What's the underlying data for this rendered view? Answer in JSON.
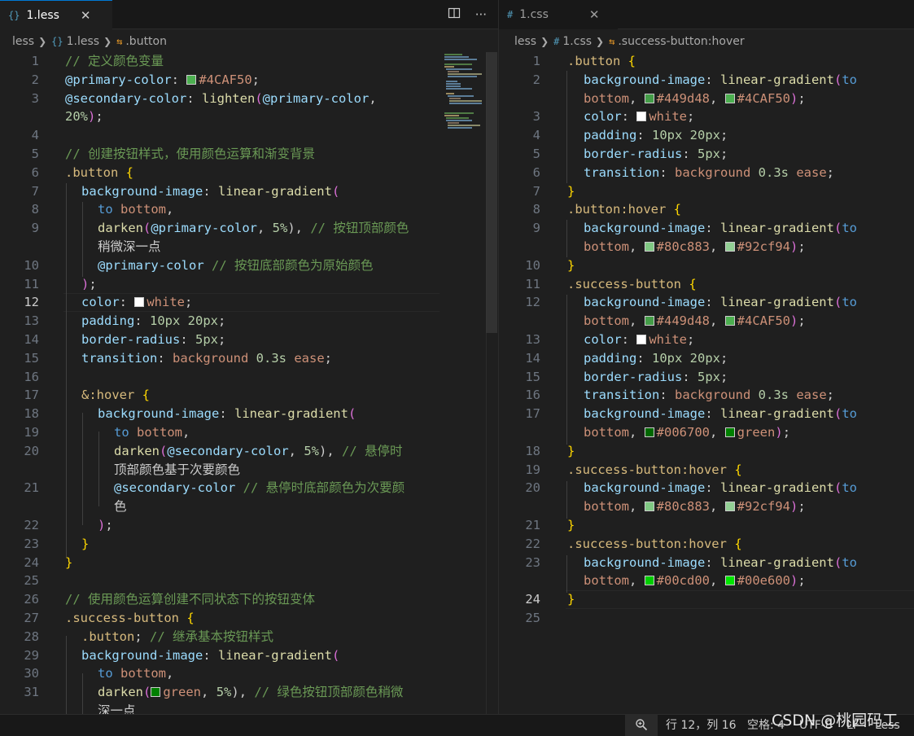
{
  "left_editor": {
    "tab": {
      "icon": "{}",
      "label": "1.less"
    },
    "breadcrumb": [
      "less",
      "1.less",
      ".button"
    ],
    "current_line": 12
  },
  "right_editor": {
    "tab": {
      "icon": "#",
      "label": "1.css"
    },
    "breadcrumb": [
      "less",
      "1.css",
      ".success-button:hover"
    ],
    "current_line": 24
  },
  "status": {
    "position": "行 12，列 16",
    "spaces": "空格: 4",
    "encoding": "UTF-8",
    "eol": "LF",
    "language": "Less"
  },
  "watermark": "CSDN @桃园码工",
  "colors": {
    "accent": "#0078d4",
    "swatch_449d48": "#449d48",
    "swatch_4CAF50": "#4CAF50",
    "swatch_white": "#ffffff",
    "swatch_80c883": "#80c883",
    "swatch_92cf94": "#92cf94",
    "swatch_006700": "#006700",
    "swatch_green": "#008000",
    "swatch_00cd00": "#00cd00",
    "swatch_00e600": "#00e600"
  },
  "icons": [
    "less-file-icon",
    "css-file-icon",
    "close-icon",
    "split-editor-icon",
    "more-actions-icon",
    "chevron-right-icon",
    "symbol-class-icon",
    "zoom-icon"
  ],
  "left_code": [
    {
      "n": "1",
      "t": "// 定义颜色变量"
    },
    {
      "n": "2",
      "t": "@primary-color: #4CAF50;"
    },
    {
      "n": "3",
      "t": "@secondary-color: lighten(@primary-color,"
    },
    {
      "n": "",
      "t": "20%);"
    },
    {
      "n": "4",
      "t": ""
    },
    {
      "n": "5",
      "t": "// 创建按钮样式，使用颜色运算和渐变背景"
    },
    {
      "n": "6",
      "t": ".button {"
    },
    {
      "n": "7",
      "t": "background-image: linear-gradient("
    },
    {
      "n": "8",
      "t": "to bottom,"
    },
    {
      "n": "9",
      "t": "darken(@primary-color, 5%), // 按钮顶部颜色"
    },
    {
      "n": "",
      "t": "稍微深一点"
    },
    {
      "n": "10",
      "t": "@primary-color // 按钮底部颜色为原始颜色"
    },
    {
      "n": "11",
      "t": ");"
    },
    {
      "n": "12",
      "t": "color: white;"
    },
    {
      "n": "13",
      "t": "padding: 10px 20px;"
    },
    {
      "n": "14",
      "t": "border-radius: 5px;"
    },
    {
      "n": "15",
      "t": "transition: background 0.3s ease;"
    },
    {
      "n": "16",
      "t": ""
    },
    {
      "n": "17",
      "t": "&:hover {"
    },
    {
      "n": "18",
      "t": "background-image: linear-gradient("
    },
    {
      "n": "19",
      "t": "to bottom,"
    },
    {
      "n": "20",
      "t": "darken(@secondary-color, 5%), // 悬停时"
    },
    {
      "n": "",
      "t": "顶部颜色基于次要颜色"
    },
    {
      "n": "21",
      "t": "@secondary-color // 悬停时底部颜色为次要颜"
    },
    {
      "n": "",
      "t": "色"
    },
    {
      "n": "22",
      "t": ");"
    },
    {
      "n": "23",
      "t": "}"
    },
    {
      "n": "24",
      "t": "}"
    },
    {
      "n": "25",
      "t": ""
    },
    {
      "n": "26",
      "t": "// 使用颜色运算创建不同状态下的按钮变体"
    },
    {
      "n": "27",
      "t": ".success-button {"
    },
    {
      "n": "28",
      "t": ".button; // 继承基本按钮样式"
    },
    {
      "n": "29",
      "t": "background-image: linear-gradient("
    },
    {
      "n": "30",
      "t": "to bottom,"
    },
    {
      "n": "31",
      "t": "darken(green, 5%), // 绿色按钮顶部颜色稍微"
    },
    {
      "n": "",
      "t": "深一点"
    }
  ],
  "right_code": [
    {
      "n": "1",
      "t": ".button {"
    },
    {
      "n": "2",
      "t": "background-image: linear-gradient(to"
    },
    {
      "n": "",
      "t": "bottom, #449d48, #4CAF50);"
    },
    {
      "n": "3",
      "t": "color: white;"
    },
    {
      "n": "4",
      "t": "padding: 10px 20px;"
    },
    {
      "n": "5",
      "t": "border-radius: 5px;"
    },
    {
      "n": "6",
      "t": "transition: background 0.3s ease;"
    },
    {
      "n": "7",
      "t": "}"
    },
    {
      "n": "8",
      "t": ".button:hover {"
    },
    {
      "n": "9",
      "t": "background-image: linear-gradient(to"
    },
    {
      "n": "",
      "t": "bottom, #80c883, #92cf94);"
    },
    {
      "n": "10",
      "t": "}"
    },
    {
      "n": "11",
      "t": ".success-button {"
    },
    {
      "n": "12",
      "t": "background-image: linear-gradient(to"
    },
    {
      "n": "",
      "t": "bottom, #449d48, #4CAF50);"
    },
    {
      "n": "13",
      "t": "color: white;"
    },
    {
      "n": "14",
      "t": "padding: 10px 20px;"
    },
    {
      "n": "15",
      "t": "border-radius: 5px;"
    },
    {
      "n": "16",
      "t": "transition: background 0.3s ease;"
    },
    {
      "n": "17",
      "t": "background-image: linear-gradient(to"
    },
    {
      "n": "",
      "t": "bottom, #006700, green);"
    },
    {
      "n": "18",
      "t": "}"
    },
    {
      "n": "19",
      "t": ".success-button:hover {"
    },
    {
      "n": "20",
      "t": "background-image: linear-gradient(to"
    },
    {
      "n": "",
      "t": "bottom, #80c883, #92cf94);"
    },
    {
      "n": "21",
      "t": "}"
    },
    {
      "n": "22",
      "t": ".success-button:hover {"
    },
    {
      "n": "23",
      "t": "background-image: linear-gradient(to"
    },
    {
      "n": "",
      "t": "bottom, #00cd00, #00e600);"
    },
    {
      "n": "24",
      "t": "}"
    },
    {
      "n": "25",
      "t": ""
    }
  ]
}
